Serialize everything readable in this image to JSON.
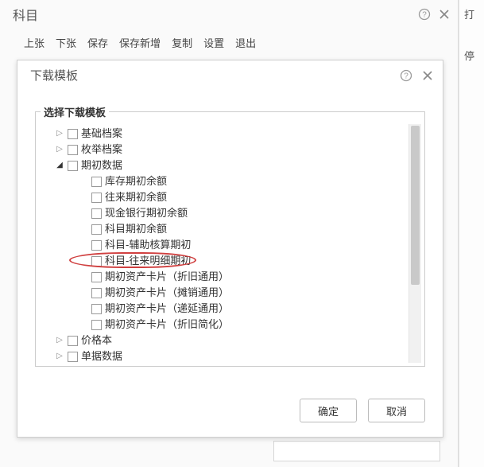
{
  "outer": {
    "title": "科目",
    "toolbar": [
      "上张",
      "下张",
      "保存",
      "保存新增",
      "复制",
      "设置",
      "退出"
    ]
  },
  "right_strip": {
    "label1": "打",
    "label2": "停"
  },
  "dialog": {
    "title": "下载模板",
    "group_legend": "选择下载模板",
    "ok_label": "确定",
    "cancel_label": "取消"
  },
  "tree": [
    {
      "level": 1,
      "toggle": "collapsed",
      "label": "基础档案"
    },
    {
      "level": 1,
      "toggle": "collapsed",
      "label": "枚举档案"
    },
    {
      "level": 1,
      "toggle": "expanded",
      "label": "期初数据"
    },
    {
      "level": 2,
      "toggle": "none",
      "label": "库存期初余额"
    },
    {
      "level": 2,
      "toggle": "none",
      "label": "往来期初余额"
    },
    {
      "level": 2,
      "toggle": "none",
      "label": "现金银行期初余额"
    },
    {
      "level": 2,
      "toggle": "none",
      "label": "科目期初余额"
    },
    {
      "level": 2,
      "toggle": "none",
      "label": "科目-辅助核算期初"
    },
    {
      "level": 2,
      "toggle": "none",
      "label": "科目-往来明细期初",
      "highlight": true
    },
    {
      "level": 2,
      "toggle": "none",
      "label": "期初资产卡片（折旧通用）"
    },
    {
      "level": 2,
      "toggle": "none",
      "label": "期初资产卡片（摊销通用）"
    },
    {
      "level": 2,
      "toggle": "none",
      "label": "期初资产卡片（递延通用）"
    },
    {
      "level": 2,
      "toggle": "none",
      "label": "期初资产卡片（折旧简化）"
    },
    {
      "level": 1,
      "toggle": "collapsed",
      "label": "价格本"
    },
    {
      "level": 1,
      "toggle": "collapsed",
      "label": "单据数据"
    }
  ]
}
